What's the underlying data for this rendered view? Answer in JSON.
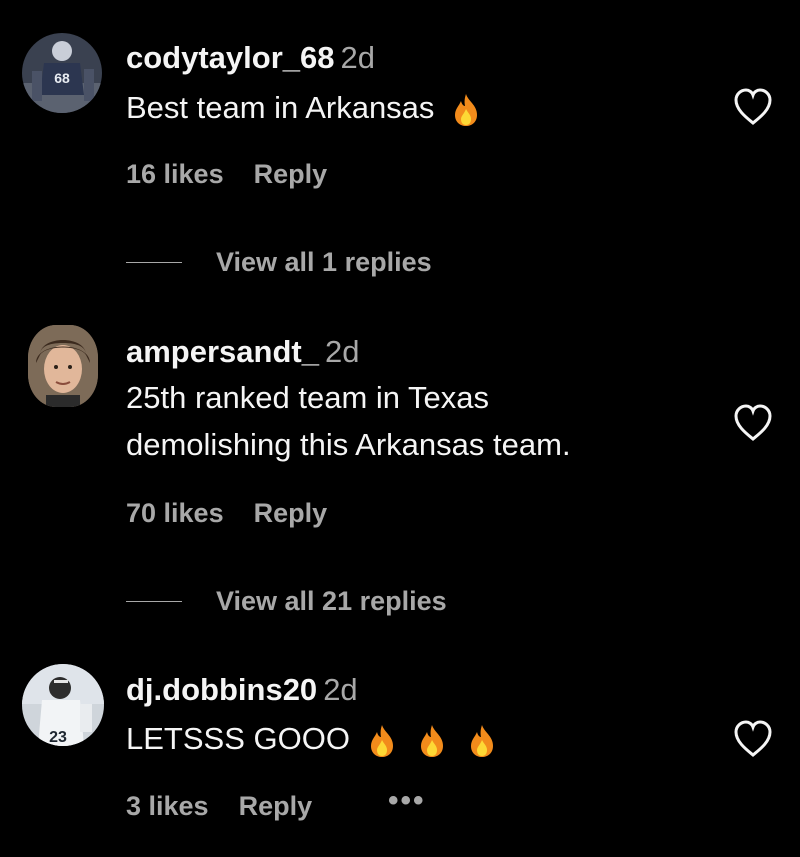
{
  "comments": [
    {
      "username": "codytaylor_68",
      "time": "2d",
      "lines": [
        "Best team in Arkansas"
      ],
      "emoji": [
        "fire"
      ],
      "likes": "16 likes",
      "reply": "Reply",
      "view_replies": "View all 1 replies",
      "avatar_icon": "football-player-avatar"
    },
    {
      "username": "ampersandt_",
      "time": "2d",
      "lines": [
        "25th ranked team in Texas",
        "demolishing this Arkansas team."
      ],
      "emoji": [],
      "likes": "70 likes",
      "reply": "Reply",
      "view_replies": "View all 21 replies",
      "avatar_icon": "person-portrait-avatar"
    },
    {
      "username": "dj.dobbins20",
      "time": "2d",
      "lines": [
        "LETSSS GOOO"
      ],
      "emoji": [
        "fire",
        "fire",
        "fire"
      ],
      "likes": "3 likes",
      "reply": "Reply",
      "more": "•••",
      "avatar_icon": "football-player-avatar"
    }
  ],
  "colors": {
    "background": "#000000",
    "primary_text": "#f5f5f5",
    "secondary_text": "#a8a8a8",
    "fire_outer": "#f28b1b",
    "fire_inner": "#fdd835"
  }
}
